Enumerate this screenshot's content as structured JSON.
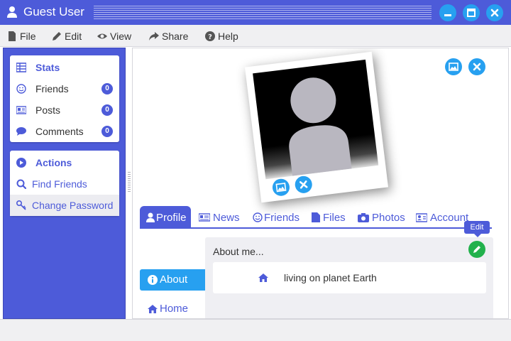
{
  "window": {
    "title": "Guest User"
  },
  "menu": {
    "file": "File",
    "edit": "Edit",
    "view": "View",
    "share": "Share",
    "help": "Help"
  },
  "sidebar": {
    "stats": {
      "header": "Stats",
      "items": [
        {
          "label": "Friends",
          "count": "0",
          "icon": "smile-icon"
        },
        {
          "label": "Posts",
          "count": "0",
          "icon": "newspaper-icon"
        },
        {
          "label": "Comments",
          "count": "0",
          "icon": "comment-icon"
        }
      ]
    },
    "actions": {
      "header": "Actions",
      "items": [
        {
          "label": "Find Friends",
          "icon": "search-icon"
        },
        {
          "label": "Change Password",
          "icon": "key-icon"
        }
      ]
    }
  },
  "tabs": [
    {
      "label": "Profile",
      "icon": "user-icon",
      "active": true
    },
    {
      "label": "News",
      "icon": "newspaper-icon"
    },
    {
      "label": "Friends",
      "icon": "smile-icon"
    },
    {
      "label": "Files",
      "icon": "file-icon"
    },
    {
      "label": "Photos",
      "icon": "camera-icon"
    },
    {
      "label": "Account",
      "icon": "id-card-icon"
    }
  ],
  "subnav": {
    "about": "About",
    "home": "Home"
  },
  "about": {
    "title": "About me...",
    "home_text": "living on planet Earth",
    "edit_tooltip": "Edit"
  },
  "colors": {
    "brand": "#4d5bd9",
    "accent": "#27a0f0",
    "success": "#22b14c"
  }
}
